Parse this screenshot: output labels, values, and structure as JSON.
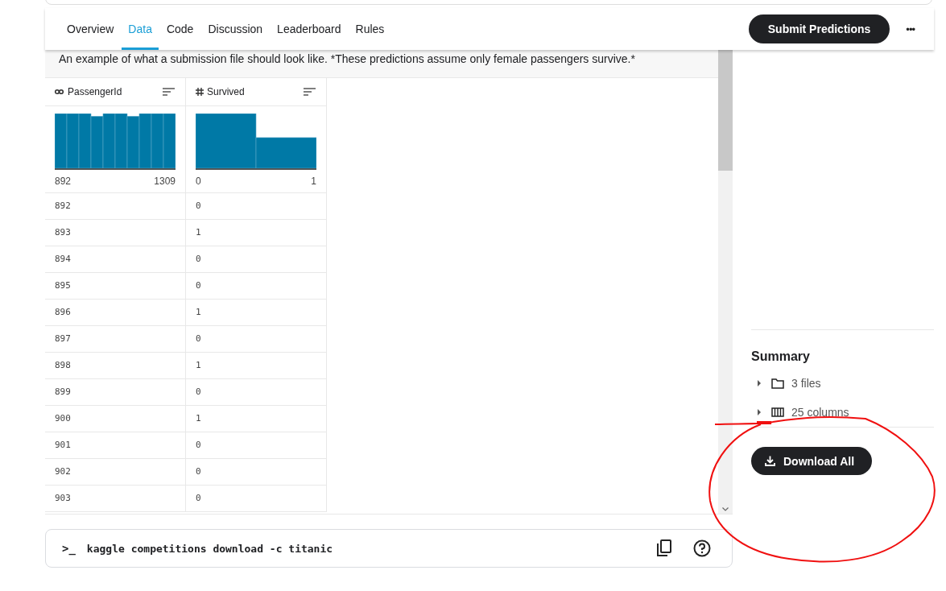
{
  "tabs": [
    {
      "label": "Overview",
      "selected": false
    },
    {
      "label": "Data",
      "selected": true
    },
    {
      "label": "Code",
      "selected": false
    },
    {
      "label": "Discussion",
      "selected": false
    },
    {
      "label": "Leaderboard",
      "selected": false
    },
    {
      "label": "Rules",
      "selected": false
    }
  ],
  "submit_button": "Submit Predictions",
  "more_button": "•••",
  "description": "An example of what a submission file should look like. *These predictions assume only female passengers survive.*",
  "table": {
    "columns": [
      {
        "name": "PassengerId",
        "kind": "id",
        "min": "892",
        "max": "1309"
      },
      {
        "name": "Survived",
        "kind": "number",
        "min": "0",
        "max": "1"
      }
    ],
    "rows": [
      [
        "892",
        "0"
      ],
      [
        "893",
        "1"
      ],
      [
        "894",
        "0"
      ],
      [
        "895",
        "0"
      ],
      [
        "896",
        "1"
      ],
      [
        "897",
        "0"
      ],
      [
        "898",
        "1"
      ],
      [
        "899",
        "0"
      ],
      [
        "900",
        "1"
      ],
      [
        "901",
        "0"
      ],
      [
        "902",
        "0"
      ],
      [
        "903",
        "0"
      ]
    ]
  },
  "summary": {
    "title": "Summary",
    "items": [
      {
        "kind": "files",
        "label": "3 files",
        "expanded": false
      },
      {
        "kind": "columns",
        "label": "25 columns",
        "expanded": false
      }
    ]
  },
  "download_button": "Download All",
  "command": {
    "prompt": ">_",
    "text": "kaggle competitions download -c titanic"
  }
}
